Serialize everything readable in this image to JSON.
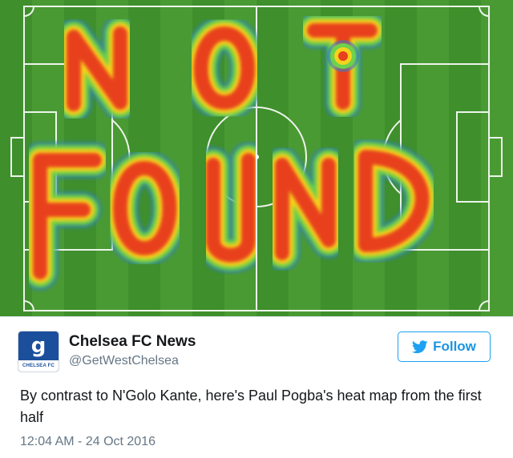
{
  "media": {
    "image_name": "pitch-heatmap-image",
    "heat_text": [
      "NOT",
      "FOUND"
    ],
    "colors": {
      "grass": "#3f8f2c",
      "grass_stripe": "#4a9a33",
      "heat_hot": "#e8401c",
      "heat_warm": "#f5d31c",
      "heat_cool": "#6fd24a",
      "heat_edge": "#2e7ed0",
      "line": "#ffffff"
    }
  },
  "author": {
    "display_name": "Chelsea FC News",
    "handle": "@GetWestChelsea",
    "avatar_letter": "g",
    "avatar_caption": "CHELSEA FC"
  },
  "follow_button": {
    "label": "Follow",
    "icon": "twitter-bird-icon"
  },
  "tweet": {
    "text": "By contrast to N'Golo Kante, here's Paul Pogba's heat map from the first half",
    "timestamp": "12:04 AM - 24 Oct 2016"
  },
  "colors": {
    "accent": "#1da1f2",
    "text": "#14171a",
    "muted": "#657786"
  }
}
